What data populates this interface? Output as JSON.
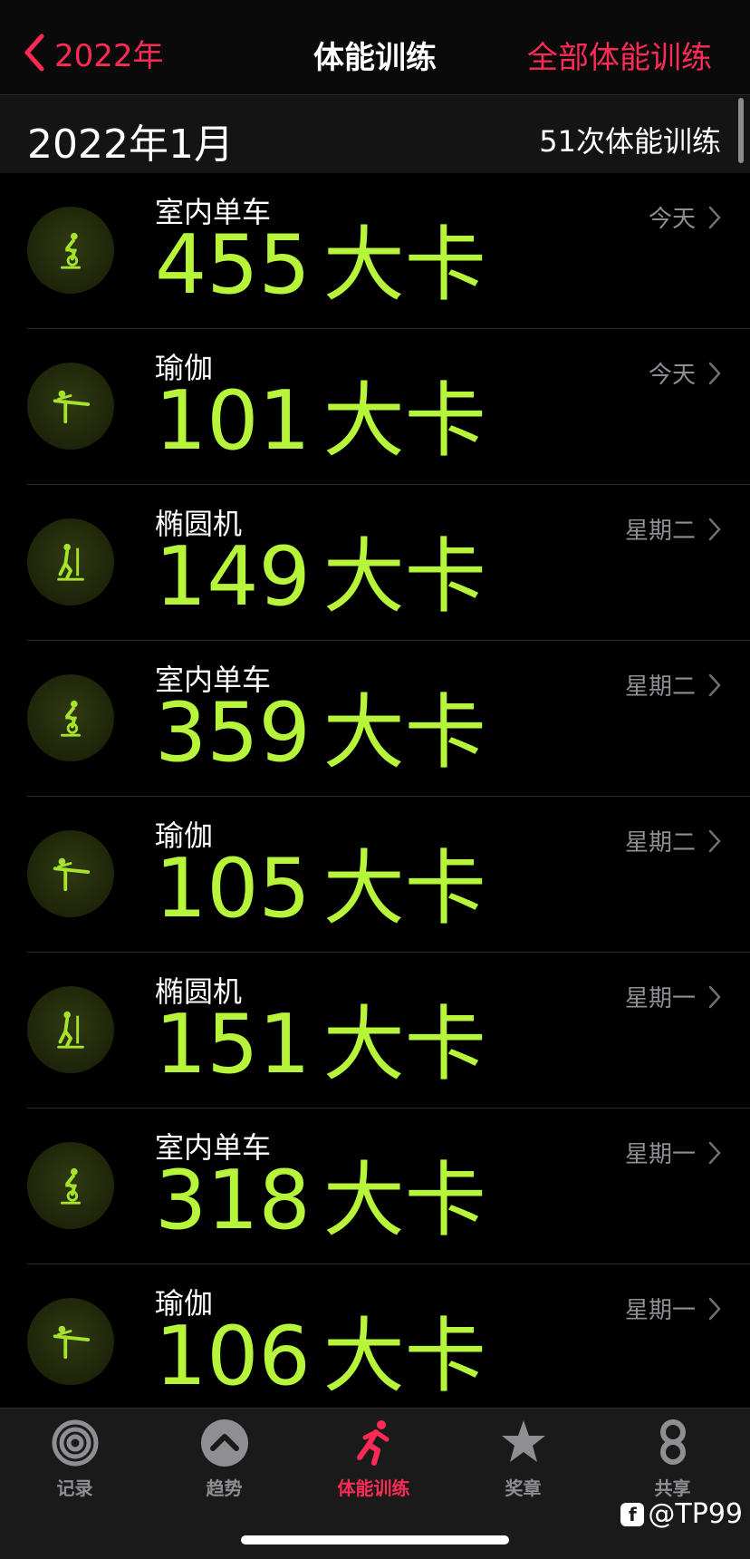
{
  "navbar": {
    "back_label": "2022年",
    "title": "体能训练",
    "right_label": "全部体能训练"
  },
  "month": {
    "title": "2022年1月",
    "count": "51次体能训练"
  },
  "workouts": [
    {
      "name": "室内单车",
      "calories": "455",
      "unit": "大卡",
      "date": "今天",
      "icon": "indoor-cycle-icon"
    },
    {
      "name": "瑜伽",
      "calories": "101",
      "unit": "大卡",
      "date": "今天",
      "icon": "yoga-icon"
    },
    {
      "name": "椭圆机",
      "calories": "149",
      "unit": "大卡",
      "date": "星期二",
      "icon": "elliptical-icon"
    },
    {
      "name": "室内单车",
      "calories": "359",
      "unit": "大卡",
      "date": "星期二",
      "icon": "indoor-cycle-icon"
    },
    {
      "name": "瑜伽",
      "calories": "105",
      "unit": "大卡",
      "date": "星期二",
      "icon": "yoga-icon"
    },
    {
      "name": "椭圆机",
      "calories": "151",
      "unit": "大卡",
      "date": "星期一",
      "icon": "elliptical-icon"
    },
    {
      "name": "室内单车",
      "calories": "318",
      "unit": "大卡",
      "date": "星期一",
      "icon": "indoor-cycle-icon"
    },
    {
      "name": "瑜伽",
      "calories": "106",
      "unit": "大卡",
      "date": "星期一",
      "icon": "yoga-icon"
    }
  ],
  "tabbar": {
    "tabs": [
      {
        "label": "记录",
        "icon": "activity-rings-icon"
      },
      {
        "label": "趋势",
        "icon": "trends-chevron-icon"
      },
      {
        "label": "体能训练",
        "icon": "running-figure-icon",
        "active": true
      },
      {
        "label": "奖章",
        "icon": "award-star-icon"
      },
      {
        "label": "共享",
        "icon": "sharing-icon"
      }
    ]
  },
  "watermark": {
    "text": "@TP99"
  },
  "colors": {
    "accent": "#ff2a55",
    "calories": "#b7f53a",
    "icon_green": "#a6e22e",
    "background": "#000000"
  }
}
